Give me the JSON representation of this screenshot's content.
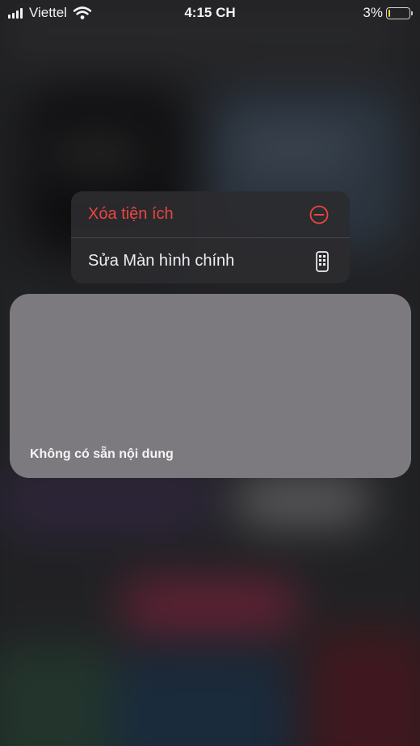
{
  "status_bar": {
    "carrier": "Viettel",
    "time": "4:15 CH",
    "battery_percent": "3%",
    "battery_level": 0.03,
    "icons": [
      "signal-icon",
      "wifi-icon",
      "battery-icon"
    ]
  },
  "context_menu": {
    "items": [
      {
        "label": "Xóa tiện ích",
        "icon": "minus-circle-icon",
        "style": "destructive",
        "color": "#e8473e"
      },
      {
        "label": "Sửa Màn hình chính",
        "icon": "phone-app-grid-icon",
        "style": "normal",
        "color": "#eeeeee"
      }
    ]
  },
  "widget": {
    "message": "Không có sẵn nội dung",
    "background_color": "#7c7a7f"
  }
}
